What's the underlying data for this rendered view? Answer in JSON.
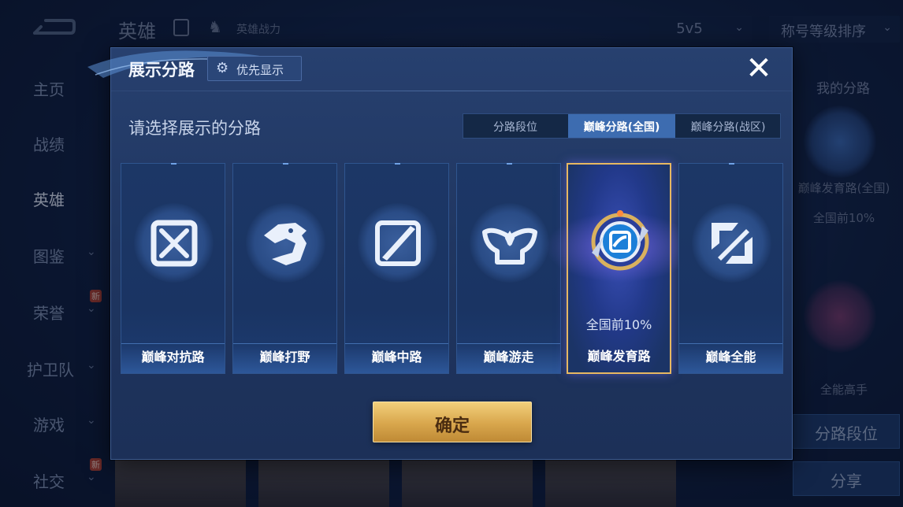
{
  "app": {
    "sidebar": [
      {
        "label": "主页",
        "chevron": false,
        "badge": ""
      },
      {
        "label": "战绩",
        "chevron": false,
        "badge": ""
      },
      {
        "label": "英雄",
        "chevron": false,
        "badge": "",
        "active": true
      },
      {
        "label": "图鉴",
        "chevron": true,
        "badge": ""
      },
      {
        "label": "荣誉",
        "chevron": true,
        "badge": "新"
      },
      {
        "label": "护卫队",
        "chevron": true,
        "badge": ""
      },
      {
        "label": "游戏",
        "chevron": true,
        "badge": ""
      },
      {
        "label": "社交",
        "chevron": true,
        "badge": "新"
      }
    ],
    "top": {
      "title": "英雄",
      "power_label": "英雄战力",
      "mode_select": "5v5",
      "sort_select": "称号等级排序"
    },
    "right_panel": {
      "title": "我的分路",
      "lane_name": "巅峰发育路(全国)",
      "lane_rank": "全国前10%",
      "second_text": "全能高手",
      "lane_rank_button": "分路段位",
      "share_button": "分享"
    }
  },
  "modal": {
    "title": "展示分路",
    "priority_label": "优先显示",
    "close_symbol": "✕",
    "subtitle": "请选择展示的分路",
    "tabs": [
      {
        "label": "分路段位",
        "active": false
      },
      {
        "label": "巅峰分路(全国)",
        "active": true
      },
      {
        "label": "巅峰分路(战区)",
        "active": false
      }
    ],
    "cards": [
      {
        "name": "巅峰对抗路",
        "icon": "crossed-swords-icon",
        "rank": "",
        "selected": false
      },
      {
        "name": "巅峰打野",
        "icon": "dragon-icon",
        "rank": "",
        "selected": false
      },
      {
        "name": "巅峰中路",
        "icon": "diagonal-blade-icon",
        "rank": "",
        "selected": false
      },
      {
        "name": "巅峰游走",
        "icon": "wings-icon",
        "rank": "",
        "selected": false
      },
      {
        "name": "巅峰发育路",
        "icon": "marksman-badge-icon",
        "rank": "全国前10%",
        "selected": true
      },
      {
        "name": "巅峰全能",
        "icon": "allround-icon",
        "rank": "",
        "selected": false
      }
    ],
    "confirm_label": "确定"
  },
  "colors": {
    "accent_blue": "#3d6cb0",
    "gold": "#d8a64c",
    "selected_border": "#e7b861"
  }
}
